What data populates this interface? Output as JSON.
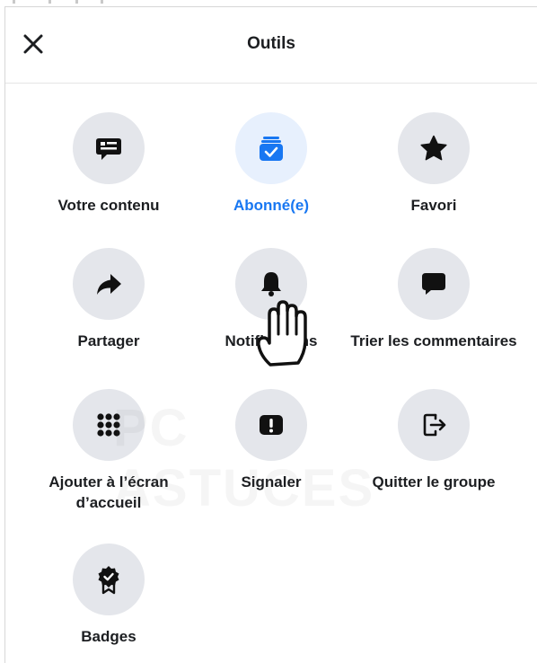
{
  "header": {
    "title": "Outils",
    "close_icon": "close-icon"
  },
  "tools": [
    {
      "label": "Votre contenu",
      "icon": "content-icon",
      "active": false
    },
    {
      "label": "Abonné(e)",
      "icon": "subscribed-icon",
      "active": true
    },
    {
      "label": "Favori",
      "icon": "star-icon",
      "active": false
    },
    {
      "label": "Partager",
      "icon": "share-icon",
      "active": false
    },
    {
      "label": "Notifications",
      "icon": "bell-icon",
      "active": false
    },
    {
      "label": "Trier les commentaires",
      "icon": "comment-icon",
      "active": false
    },
    {
      "label": "Ajouter à l’écran d’accueil",
      "icon": "grid-dots-icon",
      "active": false
    },
    {
      "label": "Signaler",
      "icon": "report-icon",
      "active": false
    },
    {
      "label": "Quitter le groupe",
      "icon": "leave-icon",
      "active": false
    },
    {
      "label": "Badges",
      "icon": "badge-icon",
      "active": false
    }
  ],
  "watermark": "PC ASTUCES",
  "colors": {
    "accent": "#1877f2",
    "icon_bg": "#e4e6eb",
    "active_bg": "#e7f0fd",
    "text": "#1c1e21"
  }
}
